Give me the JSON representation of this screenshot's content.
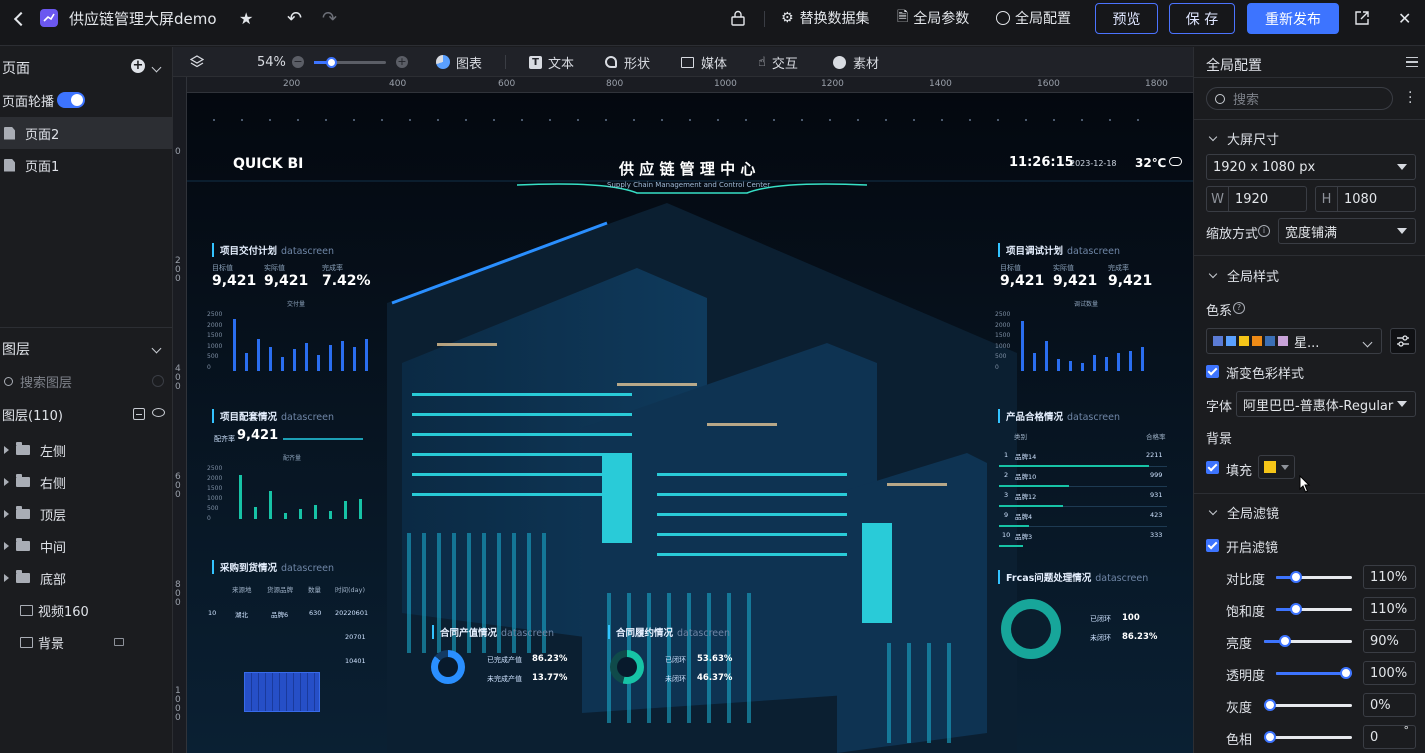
{
  "app": {
    "title": "供应链管理大屏demo",
    "actions": {
      "replace_dataset": "替换数据集",
      "global_params": "全局参数",
      "global_config": "全局配置",
      "preview": "预览",
      "save": "保 存",
      "republish": "重新发布"
    }
  },
  "left": {
    "pages_title": "页面",
    "carousel_label": "页面轮播",
    "pages": [
      {
        "label": "页面2"
      },
      {
        "label": "页面1"
      }
    ],
    "layers_title": "图层",
    "layer_search_placeholder": "搜索图层",
    "layer_count": "图层(110)",
    "layers": [
      {
        "label": "左侧"
      },
      {
        "label": "右侧"
      },
      {
        "label": "顶层"
      },
      {
        "label": "中间"
      },
      {
        "label": "底部"
      },
      {
        "label": "视频160"
      },
      {
        "label": "背景"
      }
    ]
  },
  "toolbar": {
    "zoom": "54%",
    "items": [
      {
        "label": "图表"
      },
      {
        "label": "文本"
      },
      {
        "label": "形状"
      },
      {
        "label": "媒体"
      },
      {
        "label": "交互"
      },
      {
        "label": "素材"
      }
    ]
  },
  "ruler": {
    "h_ticks": [
      "200",
      "400",
      "600",
      "800",
      "1000",
      "1200",
      "1400",
      "1600",
      "1800"
    ],
    "v_ticks": [
      "0",
      "2\n0\n0",
      "4\n0\n0",
      "6\n0\n0",
      "8\n0\n0",
      "1\n0\n0\n0"
    ]
  },
  "dashboard": {
    "brand": "QUICK BI",
    "title": "供 应 链 管 理 中 心",
    "subtitle": "Supply Chain Management and Control Center",
    "time": "11:26:15",
    "date": "2023-12-18",
    "temp": "32℃",
    "left_panel_1": {
      "title": "项目交付计划",
      "tag": "datascreen",
      "labels": [
        "目标值",
        "实际值",
        "完成率"
      ],
      "values": [
        "9,421",
        "9,421",
        "7.42%"
      ],
      "legend": "交付量",
      "y_ticks": [
        "2500",
        "2000",
        "1500",
        "1000",
        "500",
        "0"
      ]
    },
    "left_panel_2": {
      "title": "项目配套情况",
      "tag": "datascreen",
      "rate_label": "配齐率",
      "rate_value": "9,421",
      "legend": "配齐量",
      "y_ticks": [
        "2500",
        "2000",
        "1500",
        "1000",
        "500",
        "0"
      ]
    },
    "left_panel_3": {
      "title": "采购到货情况",
      "tag": "datascreen",
      "headers": [
        "来源地",
        "货源品牌",
        "数量",
        "时间(day)"
      ],
      "rows": [
        [
          "10",
          "湖北",
          "品牌6",
          "630",
          "20220601"
        ],
        [
          "",
          "",
          "",
          "",
          "20701"
        ],
        [
          "",
          "",
          "",
          "",
          "10401"
        ]
      ]
    },
    "right_panel_1": {
      "title": "项目调试计划",
      "tag": "datascreen",
      "labels": [
        "目标值",
        "实际值",
        "完成率"
      ],
      "values": [
        "9,421",
        "9,421",
        "9,421"
      ],
      "legend": "调试数量",
      "y_ticks": [
        "2500",
        "2000",
        "1500",
        "1000",
        "500",
        "0"
      ]
    },
    "right_panel_2": {
      "title": "产品合格情况",
      "tag": "datascreen",
      "headers": [
        "类别",
        "合格率"
      ],
      "rows": [
        [
          "1",
          "品牌14",
          "2211"
        ],
        [
          "2",
          "品牌10",
          "999"
        ],
        [
          "3",
          "品牌12",
          "931"
        ],
        [
          "9",
          "品牌4",
          "423"
        ],
        [
          "10",
          "品牌3",
          "333"
        ]
      ]
    },
    "right_panel_3": {
      "title": "Frcas问题处理情况",
      "tag": "datascreen",
      "items": [
        {
          "label": "已闭环",
          "value": "100"
        },
        {
          "label": "未闭环",
          "value": "86.23%"
        }
      ]
    },
    "bottom_1": {
      "title": "合同产值情况",
      "tag": "datascreen",
      "items": [
        {
          "label": "已完成产值",
          "value": "86.23%"
        },
        {
          "label": "未完成产值",
          "value": "13.77%"
        }
      ]
    },
    "bottom_2": {
      "title": "合同履约情况",
      "tag": "datascreen",
      "items": [
        {
          "label": "已闭环",
          "value": "53.63%"
        },
        {
          "label": "未闭环",
          "value": "46.37%"
        }
      ]
    }
  },
  "right": {
    "title": "全局配置",
    "search_placeholder": "搜索",
    "section_size": "大屏尺寸",
    "size_value": "1920 x 1080 px",
    "w_label": "W",
    "w_value": "1920",
    "h_label": "H",
    "h_value": "1080",
    "scale_label": "缩放方式",
    "scale_value": "宽度铺满",
    "section_style": "全局样式",
    "palette_label": "色系",
    "palette_name": "星...",
    "palette_colors": [
      "#5b7bd5",
      "#5aa0ff",
      "#f5c518",
      "#ef8b16",
      "#3b6fb6",
      "#c8a2d8"
    ],
    "gradient_label": "渐变色彩样式",
    "font_label": "字体",
    "font_value": "阿里巴巴-普惠体-Regular",
    "bg_label": "背景",
    "fill_label": "填充",
    "fill_color": "#f5c518",
    "section_filter": "全局滤镜",
    "enable_filter": "开启滤镜",
    "filters": [
      {
        "label": "对比度",
        "value": "110%",
        "level": 0.22
      },
      {
        "label": "饱和度",
        "value": "110%",
        "level": 0.22
      },
      {
        "label": "亮度",
        "value": "90%",
        "level": 0.2
      },
      {
        "label": "透明度",
        "value": "100%",
        "level": 1.0
      },
      {
        "label": "灰度",
        "value": "0%",
        "level": 0.0
      },
      {
        "label": "色相",
        "value": "0",
        "level": 0.0
      }
    ],
    "hue_unit": "°"
  }
}
